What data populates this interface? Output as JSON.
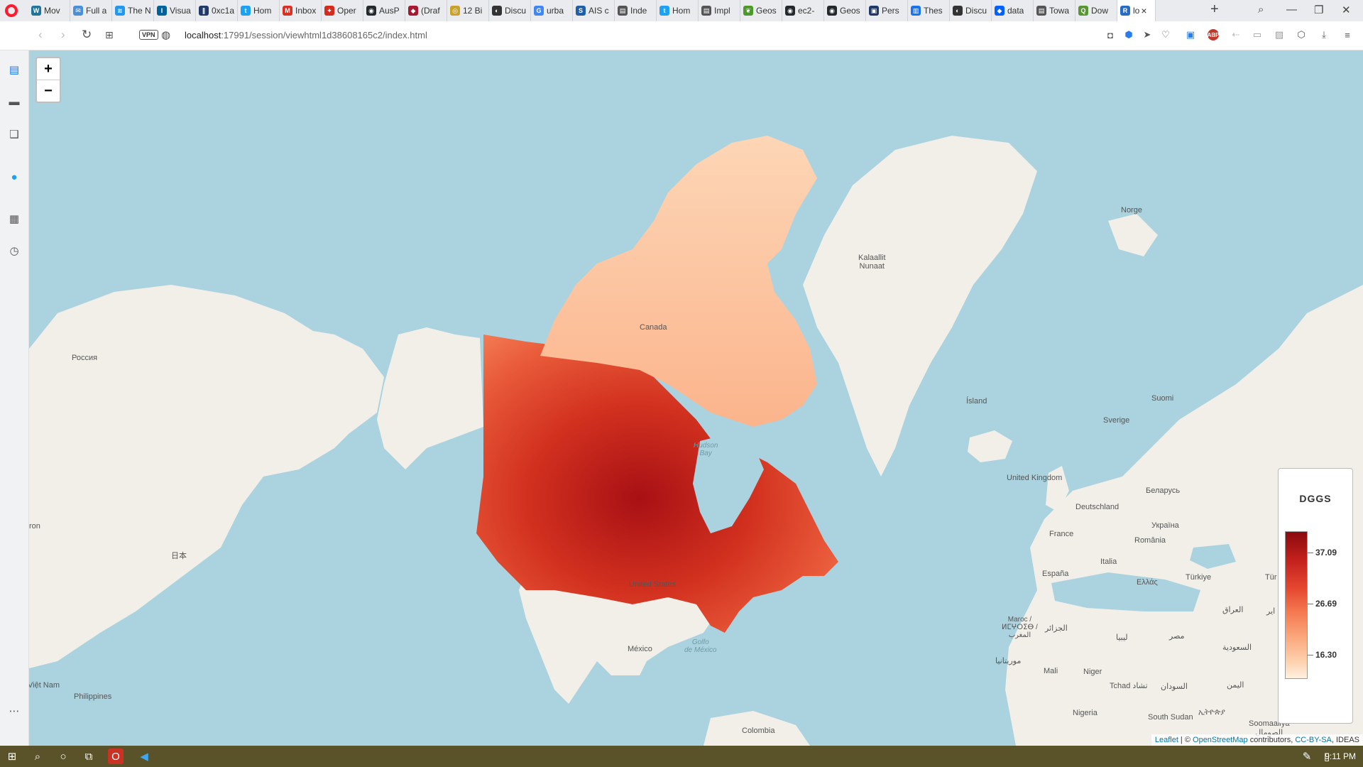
{
  "browser": {
    "tabs": [
      {
        "label": "Mov",
        "icon": "wordpress-icon",
        "color": "#21759b",
        "glyph": "W"
      },
      {
        "label": "Full a",
        "icon": "mail-icon",
        "color": "#4a90d9",
        "glyph": "✉"
      },
      {
        "label": "The N",
        "icon": "docker-icon",
        "color": "#2496ed",
        "glyph": "≋"
      },
      {
        "label": "Visua",
        "icon": "ieee-icon",
        "color": "#00629b",
        "glyph": "I"
      },
      {
        "label": "0xc1a",
        "icon": "pause-icon",
        "color": "#1f3a68",
        "glyph": "∥"
      },
      {
        "label": "Hom",
        "icon": "twitter-icon",
        "color": "#1da1f2",
        "glyph": "t"
      },
      {
        "label": "Inbox",
        "icon": "gmail-icon",
        "color": "#d93025",
        "glyph": "M"
      },
      {
        "label": "Oper",
        "icon": "maple-leaf-icon",
        "color": "#d52b1e",
        "glyph": "✦"
      },
      {
        "label": "AusP",
        "icon": "github-icon",
        "color": "#24292e",
        "glyph": "◉"
      },
      {
        "label": "(Draf",
        "icon": "shield-icon",
        "color": "#a6192e",
        "glyph": "◆"
      },
      {
        "label": "12 Bi",
        "icon": "coin-icon",
        "color": "#c9a227",
        "glyph": "◎"
      },
      {
        "label": "Discu",
        "icon": "discourse-icon",
        "color": "#333333",
        "glyph": "◐"
      },
      {
        "label": "urba",
        "icon": "google-icon",
        "color": "#4285f4",
        "glyph": "G"
      },
      {
        "label": "AIS c",
        "icon": "s-icon",
        "color": "#1f5fa8",
        "glyph": "S"
      },
      {
        "label": "Inde",
        "icon": "document-icon",
        "color": "#555555",
        "glyph": "▤"
      },
      {
        "label": "Hom",
        "icon": "twitter-icon",
        "color": "#1da1f2",
        "glyph": "t"
      },
      {
        "label": "Impl",
        "icon": "document-icon",
        "color": "#555555",
        "glyph": "▤"
      },
      {
        "label": "Geos",
        "icon": "leaf-icon",
        "color": "#4c9a2a",
        "glyph": "❦"
      },
      {
        "label": "ec2-",
        "icon": "github-icon",
        "color": "#24292e",
        "glyph": "◉"
      },
      {
        "label": "Geos",
        "icon": "github-icon",
        "color": "#24292e",
        "glyph": "◉"
      },
      {
        "label": "Pers",
        "icon": "bookmark-icon",
        "color": "#1f3a68",
        "glyph": "▣"
      },
      {
        "label": "Thes",
        "icon": "file-icon",
        "color": "#1a73e8",
        "glyph": "▥"
      },
      {
        "label": "Discu",
        "icon": "discourse-icon",
        "color": "#333333",
        "glyph": "◐"
      },
      {
        "label": "data",
        "icon": "dropbox-icon",
        "color": "#0061fe",
        "glyph": "◆"
      },
      {
        "label": "Towa",
        "icon": "document-icon",
        "color": "#555555",
        "glyph": "▤"
      },
      {
        "label": "Dow",
        "icon": "qgis-icon",
        "color": "#589632",
        "glyph": "Q"
      },
      {
        "label": "lo",
        "icon": "r-icon",
        "color": "#276dc3",
        "glyph": "R",
        "active": true
      }
    ],
    "url_host": "localhost",
    "url_rest": ":17991/session/viewhtml1d38608165c2/index.html",
    "vpn_label": "VPN"
  },
  "map": {
    "zoom_in": "+",
    "zoom_out": "−",
    "labels": {
      "russia": "Россия",
      "canada": "Canada",
      "kalaallit": "Kalaallit\nNunaat",
      "norge": "Norge",
      "suomi": "Suomi",
      "sverige": "Sverige",
      "island": "Ísland",
      "uk": "United Kingdom",
      "deutschland": "Deutschland",
      "belarus": "Беларусь",
      "ukraina": "Україна",
      "france": "France",
      "romania": "România",
      "espana": "España",
      "italia": "Italia",
      "turkiye": "Türkiye",
      "ellas": "Ελλάς",
      "japan": "日本",
      "united_states": "United States",
      "mexico": "México",
      "gulf": "Golfo\nde México",
      "hudson": "Hudson\nBay",
      "maroc": "Maroc /\nⵍⵎⵖⵔⵉⴱ /\nالمغرب",
      "aljazair": "الجزائر",
      "libya": "ليبيا",
      "misr": "مصر",
      "iraq": "العراق",
      "saudi": "السعودية",
      "yemen": "اليمن",
      "mauritania": "موريتانيا",
      "mali": "Mali",
      "niger": "Niger",
      "tchad": "Tchad تشاد",
      "sudan": "السودان",
      "nigeria": "Nigeria",
      "south_sudan": "South Sudan",
      "ethiopia": "ኢትዮጵያ",
      "somalia": "Soomaaliya\nالصومال",
      "philippines": "Philippines",
      "viet_nam": "Việt Nam",
      "colombia": "Colombia",
      "tur_edge": "Tür",
      "iran_edge": "ایر",
      "ron_edge": "ron"
    },
    "legend": {
      "title": "DGGS",
      "values": [
        "37.09",
        "26.69",
        "16.30"
      ],
      "color_high": "#8a0a0f",
      "color_low": "#fff1e0"
    },
    "attribution": {
      "leaflet": "Leaflet",
      "sep": " | © ",
      "osm": "OpenStreetMap",
      "contributors": " contributors, ",
      "license": "CC-BY-SA",
      "ideas": ", IDEAS"
    }
  },
  "taskbar": {
    "clock": "9:11 PM"
  }
}
